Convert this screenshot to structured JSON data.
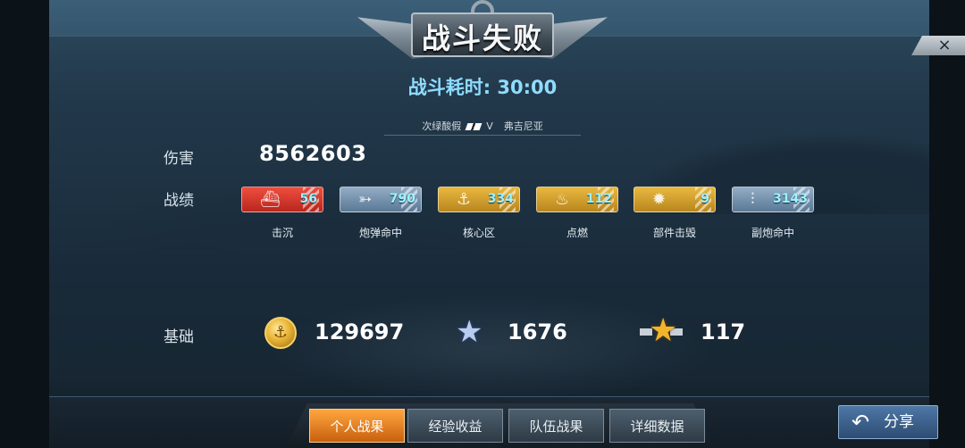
{
  "header": {
    "title": "战斗失败",
    "close_icon": "×"
  },
  "battle": {
    "duration_label": "战斗耗时: 30:00",
    "team_left": "次绿酸假",
    "vs": "V",
    "team_right": "弗吉尼亚"
  },
  "damage": {
    "label": "伤害",
    "value": "8562603"
  },
  "record": {
    "label": "战绩",
    "items": [
      {
        "icon": "ship-sunk-icon",
        "glyph": "⛴",
        "value": "56",
        "caption": "击沉",
        "color": "red"
      },
      {
        "icon": "shell-hit-icon",
        "glyph": "➳",
        "value": "790",
        "caption": "炮弹命中",
        "color": "blue"
      },
      {
        "icon": "core-area-icon",
        "glyph": "⚓",
        "value": "334",
        "caption": "核心区",
        "color": "gold"
      },
      {
        "icon": "ignite-icon",
        "glyph": "♨",
        "value": "112",
        "caption": "点燃",
        "color": "gold"
      },
      {
        "icon": "component-destroy-icon",
        "glyph": "✹",
        "value": "9",
        "caption": "部件击毁",
        "color": "gold"
      },
      {
        "icon": "secondary-gun-hit-icon",
        "glyph": "⫶",
        "value": "3143",
        "caption": "副炮命中",
        "color": "blue"
      }
    ]
  },
  "base": {
    "label": "基础",
    "coins": "129697",
    "coins_icon": "gold-coin-icon",
    "exp": "1676",
    "exp_icon": "blue-star-icon",
    "rank": "117",
    "rank_icon": "gold-star-icon"
  },
  "tabs": [
    {
      "label": "个人战果",
      "active": true
    },
    {
      "label": "经验收益",
      "active": false
    },
    {
      "label": "队伍战果",
      "active": false
    },
    {
      "label": "详细数据",
      "active": false
    }
  ],
  "share": {
    "label": "分享",
    "icon": "share-arrow-icon"
  }
}
